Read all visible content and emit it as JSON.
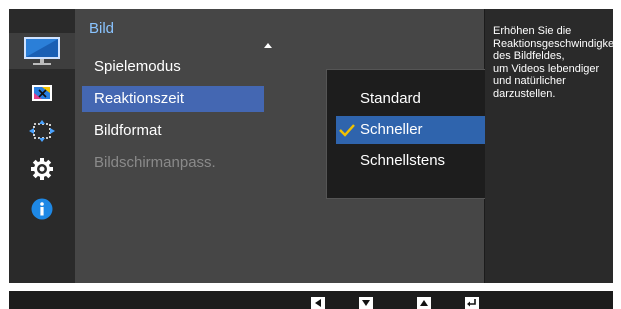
{
  "osd": {
    "title": "Bild",
    "categories": [
      {
        "icon": "picture-icon",
        "active": true
      },
      {
        "icon": "color-icon",
        "active": false
      },
      {
        "icon": "size-position-icon",
        "active": false
      },
      {
        "icon": "settings-gear-icon",
        "active": false
      },
      {
        "icon": "info-icon",
        "active": false
      }
    ],
    "menu_items": [
      {
        "label": "Spielemodus"
      },
      {
        "label": "Reaktionszeit",
        "selected": true
      },
      {
        "label": "Bildformat"
      },
      {
        "label": "Bildschirmanpass.",
        "disabled": true
      }
    ],
    "submenu": {
      "options": [
        {
          "label": "Standard"
        },
        {
          "label": "Schneller",
          "selected": true
        },
        {
          "label": "Schnellstens"
        }
      ]
    },
    "help_lines": [
      "Erhöhen Sie die",
      "Reaktionsgeschwindigkeit",
      "des Bildfeldes,",
      "um Videos lebendiger",
      "und natürlicher",
      "darzustellen."
    ]
  },
  "bottom_bar": {
    "buttons": [
      {
        "icon": "left-arrow-icon"
      },
      {
        "icon": "down-arrow-icon"
      },
      {
        "icon": "up-arrow-icon"
      },
      {
        "icon": "enter-icon"
      }
    ]
  },
  "colors": {
    "title": "#8ac4ff",
    "menu_selected": "#4467b2",
    "option_selected": "#2f64ad",
    "check": "#f2c200",
    "info": "#1e88e5"
  }
}
